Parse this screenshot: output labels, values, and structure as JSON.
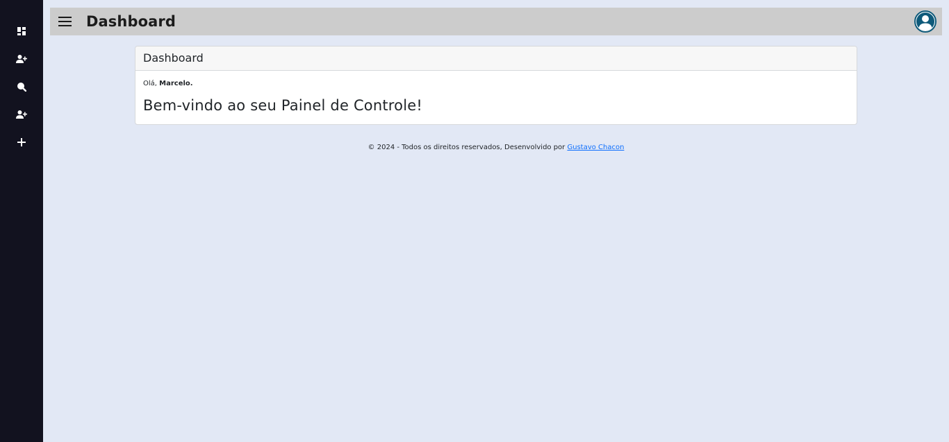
{
  "sidebar": {
    "items": [
      {
        "icon": "dashboard-icon"
      },
      {
        "icon": "add-user-icon"
      },
      {
        "icon": "search-icon"
      },
      {
        "icon": "add-user-icon"
      },
      {
        "icon": "plus-icon"
      }
    ]
  },
  "header": {
    "menu_icon": "hamburger-menu-icon",
    "title": "Dashboard",
    "avatar_icon": "user-avatar-icon"
  },
  "card": {
    "header": "Dashboard",
    "greeting_prefix": "Olá,",
    "user_name": "Marcelo.",
    "welcome": "Bem-vindo ao seu Painel de Controle!"
  },
  "footer": {
    "text": "© 2024 - Todos os direitos reservados, Desenvolvido por",
    "link_text": "Gustavo Chacon"
  },
  "colors": {
    "sidebar_bg": "#12121f",
    "page_bg": "#e2e8f5",
    "topbar_bg": "#cccccc",
    "avatar_accent": "#0e5a7a",
    "link": "#0d6efd"
  }
}
